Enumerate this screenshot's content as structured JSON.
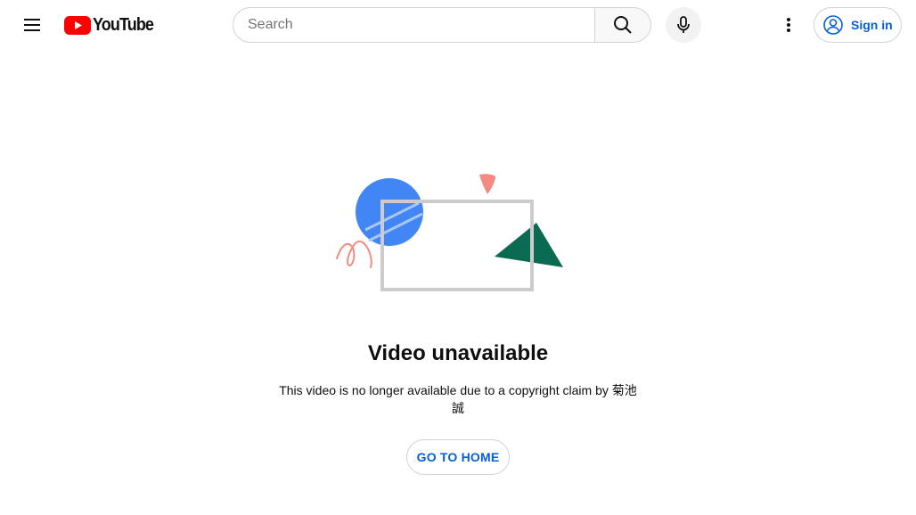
{
  "header": {
    "logo_text": "YouTube",
    "search": {
      "placeholder": "Search",
      "value": ""
    },
    "sign_in_label": "Sign in",
    "icons": [
      "menu-icon",
      "youtube-logo-icon",
      "search-icon",
      "microphone-icon",
      "more-vert-icon",
      "account-circle-icon"
    ]
  },
  "error": {
    "title": "Video unavailable",
    "message": "This video is no longer available due to a copyright claim by 菊池誠",
    "button_label": "GO TO HOME"
  },
  "colors": {
    "brand_red": "#ff0000",
    "link_blue": "#065fd4",
    "illustration_blue": "#4285f4",
    "illustration_green": "#0b6a52",
    "illustration_pink": "#f28b82",
    "frame_gray": "#cccccc"
  }
}
